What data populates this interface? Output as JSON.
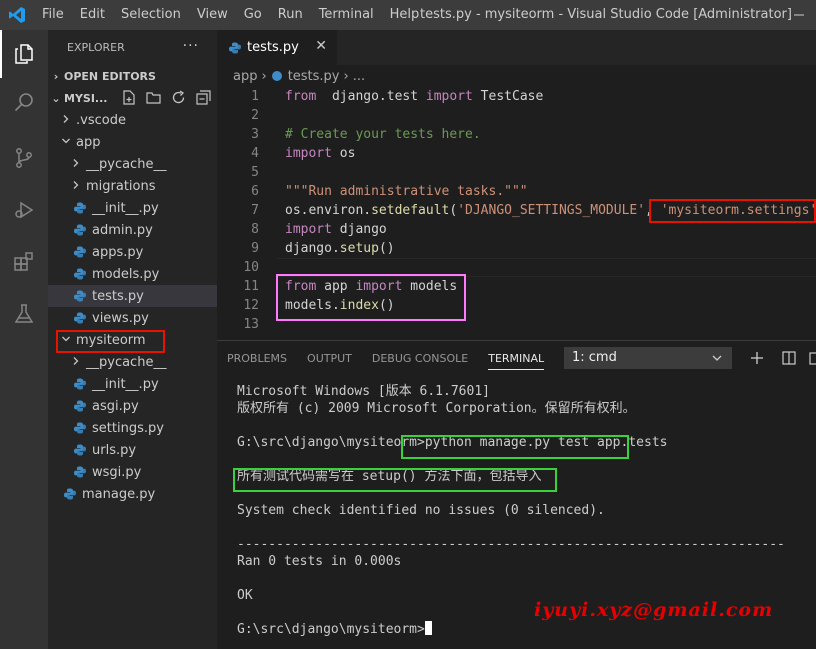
{
  "window": {
    "title": "tests.py - mysiteorm - Visual Studio Code [Administrator]",
    "menu": [
      "File",
      "Edit",
      "Selection",
      "View",
      "Go",
      "Run",
      "Terminal",
      "Help"
    ]
  },
  "sidebar": {
    "title": "EXPLORER",
    "open_editors": "OPEN EDITORS",
    "workspace": "MYSI...",
    "tree": [
      {
        "label": ".vscode",
        "type": "folder",
        "expanded": false,
        "depth": 1
      },
      {
        "label": "app",
        "type": "folder",
        "expanded": true,
        "depth": 1
      },
      {
        "label": "__pycache__",
        "type": "folder",
        "expanded": false,
        "depth": 2
      },
      {
        "label": "migrations",
        "type": "folder",
        "expanded": false,
        "depth": 2
      },
      {
        "label": "__init__.py",
        "type": "py",
        "depth": 2
      },
      {
        "label": "admin.py",
        "type": "py",
        "depth": 2
      },
      {
        "label": "apps.py",
        "type": "py",
        "depth": 2
      },
      {
        "label": "models.py",
        "type": "py",
        "depth": 2
      },
      {
        "label": "tests.py",
        "type": "py",
        "depth": 2,
        "selected": true
      },
      {
        "label": "views.py",
        "type": "py",
        "depth": 2
      },
      {
        "label": "mysiteorm",
        "type": "folder",
        "expanded": true,
        "depth": 1
      },
      {
        "label": "__pycache__",
        "type": "folder",
        "expanded": false,
        "depth": 2
      },
      {
        "label": "__init__.py",
        "type": "py",
        "depth": 2
      },
      {
        "label": "asgi.py",
        "type": "py",
        "depth": 2
      },
      {
        "label": "settings.py",
        "type": "py",
        "depth": 2
      },
      {
        "label": "urls.py",
        "type": "py",
        "depth": 2
      },
      {
        "label": "wsgi.py",
        "type": "py",
        "depth": 2
      },
      {
        "label": "manage.py",
        "type": "py",
        "depth": 1
      }
    ]
  },
  "editor": {
    "tab_label": "tests.py",
    "breadcrumb": [
      "app",
      "tests.py",
      "..."
    ],
    "lines": [
      {
        "n": "1",
        "tokens": [
          [
            "kw",
            "from"
          ],
          [
            "",
            "  django.test "
          ],
          [
            "kw",
            "import"
          ],
          [
            "",
            " TestCase"
          ]
        ]
      },
      {
        "n": "2",
        "tokens": []
      },
      {
        "n": "3",
        "tokens": [
          [
            "cm",
            "# Create your tests here."
          ]
        ]
      },
      {
        "n": "4",
        "tokens": [
          [
            "kw",
            "import"
          ],
          [
            "",
            " os"
          ]
        ]
      },
      {
        "n": "5",
        "tokens": []
      },
      {
        "n": "6",
        "tokens": [
          [
            "str",
            "\"\"\"Run administrative tasks.\"\"\""
          ]
        ]
      },
      {
        "n": "7",
        "tokens": [
          [
            "",
            "os.environ."
          ],
          [
            "fn",
            "setdefault"
          ],
          [
            "",
            "("
          ],
          [
            "str",
            "'DJANGO_SETTINGS_MODULE'"
          ],
          [
            " ",
            ", "
          ],
          [
            "str",
            "'mysiteorm.settings'"
          ],
          [
            "",
            ")"
          ]
        ]
      },
      {
        "n": "8",
        "tokens": [
          [
            "kw",
            "import"
          ],
          [
            "",
            " django"
          ]
        ]
      },
      {
        "n": "9",
        "tokens": [
          [
            "",
            "django."
          ],
          [
            "fn",
            "setup"
          ],
          [
            "",
            "()"
          ]
        ]
      },
      {
        "n": "10",
        "tokens": []
      },
      {
        "n": "11",
        "tokens": [
          [
            "kw",
            "from"
          ],
          [
            "",
            " app "
          ],
          [
            "kw",
            "import"
          ],
          [
            "",
            " models"
          ]
        ]
      },
      {
        "n": "12",
        "tokens": [
          [
            "",
            "models."
          ],
          [
            "fn",
            "index"
          ],
          [
            "",
            "()"
          ]
        ]
      },
      {
        "n": "13",
        "tokens": []
      }
    ]
  },
  "panel": {
    "tabs": [
      "PROBLEMS",
      "OUTPUT",
      "DEBUG CONSOLE",
      "TERMINAL"
    ],
    "active_tab": "TERMINAL",
    "terminal_select": "1: cmd",
    "terminal_lines": [
      "Microsoft Windows [版本 6.1.7601]",
      "版权所有 (c) 2009 Microsoft Corporation。保留所有权利。",
      "",
      "G:\\src\\django\\mysiteorm>python manage.py test app.tests",
      "",
      "所有测试代码需写在 setup() 方法下面，包括导入",
      "",
      "System check identified no issues (0 silenced).",
      "",
      "----------------------------------------------------------------------",
      "Ran 0 tests in 0.000s",
      "",
      "OK",
      "",
      "G:\\src\\django\\mysiteorm>"
    ],
    "watermark": "iyuyi.xyz@gmail.com"
  },
  "colors": {
    "highlight_red": "#e51400",
    "highlight_pink": "#ff79ff",
    "highlight_green": "#3ad13a"
  }
}
